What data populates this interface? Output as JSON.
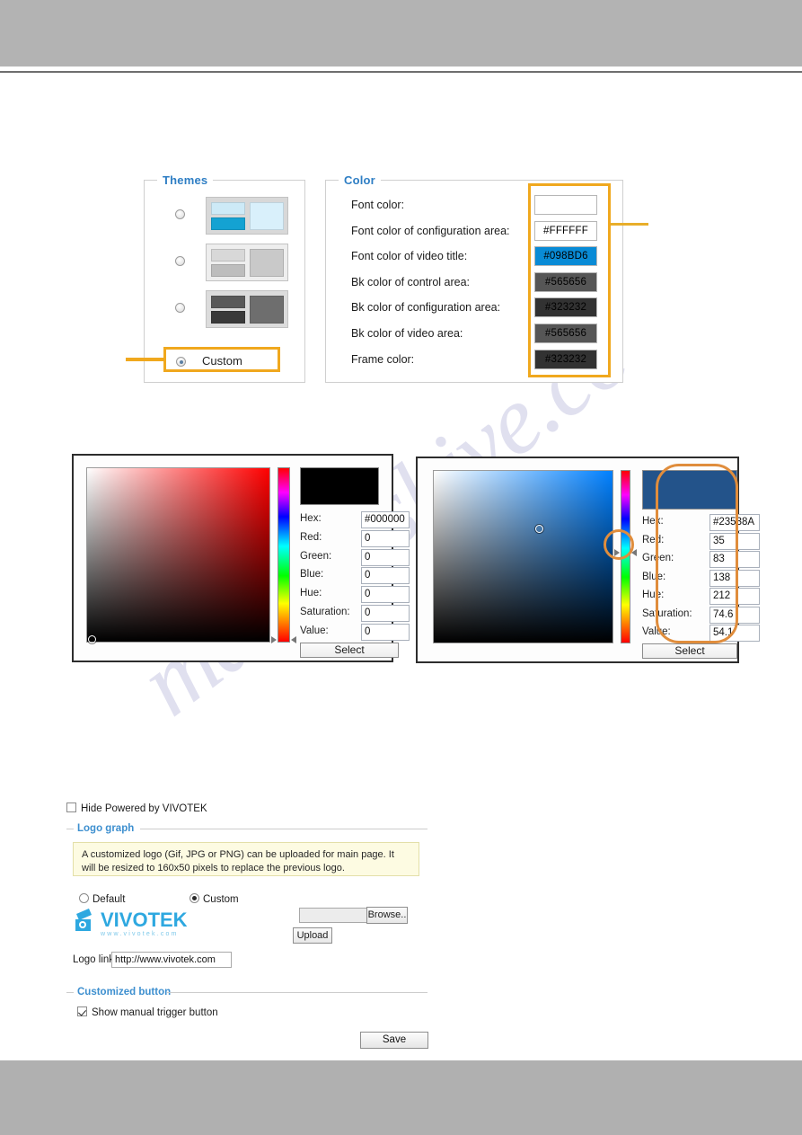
{
  "page": {
    "watermark_text": "manualshive.com"
  },
  "themes_panel": {
    "legend": "Themes",
    "items": [
      {
        "id": "theme-blue",
        "selected": false,
        "top_color": "#cdeaf7",
        "bottom_color": "#14a2d2",
        "right_color": "#d9f0fb",
        "frame_color": "#d8d8d8"
      },
      {
        "id": "theme-light",
        "selected": false,
        "top_color": "#d8d8d8",
        "bottom_color": "#bdbdbd",
        "right_color": "#c9c9c9",
        "frame_color": "#eeeeee"
      },
      {
        "id": "theme-dark",
        "selected": false,
        "top_color": "#595959",
        "bottom_color": "#3a3a3a",
        "right_color": "#6e6e6e",
        "frame_color": "#dcdcdc"
      }
    ],
    "custom": {
      "label": "Custom",
      "selected": true
    }
  },
  "color_panel": {
    "legend": "Color",
    "rows": [
      {
        "label": "Font color:",
        "value": "",
        "bg": "#ffffff",
        "fg": "#000000"
      },
      {
        "label": "Font color of configuration area:",
        "value": "#FFFFFF",
        "bg": "#ffffff",
        "fg": "#000000"
      },
      {
        "label": "Font color of video title:",
        "value": "#098BD6",
        "bg": "#098bd6",
        "fg": "#000000"
      },
      {
        "label": "Bk color of control area:",
        "value": "#565656",
        "bg": "#565656",
        "fg": "#000000"
      },
      {
        "label": "Bk color of configuration area:",
        "value": "#323232",
        "bg": "#323232",
        "fg": "#000000"
      },
      {
        "label": "Bk color of video area:",
        "value": "#565656",
        "bg": "#565656",
        "fg": "#000000"
      },
      {
        "label": "Frame color:",
        "value": "#323232",
        "bg": "#323232",
        "fg": "#000000"
      }
    ]
  },
  "picker_left": {
    "preview_color": "#000000",
    "hue_base": "#ff0000",
    "fields": [
      {
        "label": "Hex:",
        "value": "#000000"
      },
      {
        "label": "Red:",
        "value": "0"
      },
      {
        "label": "Green:",
        "value": "0"
      },
      {
        "label": "Blue:",
        "value": "0"
      },
      {
        "label": "Hue:",
        "value": "0"
      },
      {
        "label": "Saturation:",
        "value": "0"
      },
      {
        "label": "Value:",
        "value": "0"
      }
    ],
    "select_label": "Select"
  },
  "picker_right": {
    "preview_color": "#23538A",
    "hue_base": "#0080ff",
    "fields": [
      {
        "label": "Hex:",
        "value": "#23538A"
      },
      {
        "label": "Red:",
        "value": "35"
      },
      {
        "label": "Green:",
        "value": "83"
      },
      {
        "label": "Blue:",
        "value": "138"
      },
      {
        "label": "Hue:",
        "value": "212"
      },
      {
        "label": "Saturation:",
        "value": "74.6"
      },
      {
        "label": "Value:",
        "value": "54.1"
      }
    ],
    "select_label": "Select"
  },
  "lower_form": {
    "hide_powered_label": "Hide Powered by VIVOTEK",
    "hide_powered_checked": false,
    "logo_graph": {
      "legend": "Logo graph",
      "note": "A customized logo (Gif, JPG or PNG) can be uploaded for main page. It will be resized to 160x50 pixels to replace the previous logo.",
      "default_label": "Default",
      "custom_label": "Custom",
      "selected": "Custom",
      "logo_word": "VIVOTEK",
      "logo_url": "www.vivotek.com",
      "file_value": "",
      "browse_label": "Browse..",
      "upload_label": "Upload",
      "logo_link_label": "Logo link:",
      "logo_link_value": "http://www.vivotek.com"
    },
    "customized_button": {
      "legend": "Customized button",
      "show_trigger_label": "Show manual trigger button",
      "show_trigger_checked": true
    },
    "save_label": "Save"
  }
}
